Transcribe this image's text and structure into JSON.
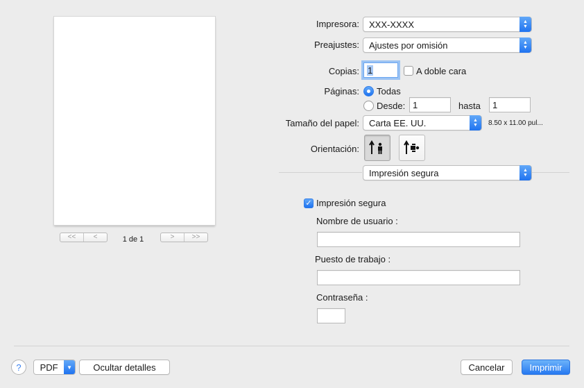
{
  "preview": {
    "page_indicator": "1 de 1",
    "pager_first": "<<",
    "pager_prev": "<",
    "pager_next": ">",
    "pager_last": ">>"
  },
  "printer": {
    "label": "Impresora:",
    "value": "XXX-XXXX"
  },
  "presets": {
    "label": "Preajustes:",
    "value": "Ajustes por omisión"
  },
  "copies": {
    "label": "Copias:",
    "value": "1",
    "duplex_label": "A doble cara",
    "duplex_checked": false
  },
  "pages": {
    "label": "Páginas:",
    "all_label": "Todas",
    "from_label": "Desde:",
    "from_value": "1",
    "to_label": "hasta",
    "to_value": "1",
    "selected": "all"
  },
  "paper": {
    "label": "Tamaño del papel:",
    "value": "Carta EE. UU.",
    "dimensions": "8.50 x 11.00 pul..."
  },
  "orientation": {
    "label": "Orientación:",
    "selected": "portrait"
  },
  "section": {
    "value": "Impresión segura"
  },
  "secure": {
    "checkbox_label": "Impresión segura",
    "checked": true,
    "username_label": "Nombre de usuario :",
    "username_value": "",
    "job_label": "Puesto de trabajo :",
    "job_value": "",
    "password_label": "Contraseña :",
    "password_value": ""
  },
  "footer": {
    "help": "?",
    "pdf_label": "PDF",
    "hide_details": "Ocultar detalles",
    "cancel": "Cancelar",
    "print": "Imprimir"
  },
  "colors": {
    "accent": "#2779f1",
    "background": "#ececec"
  },
  "icons": {
    "popup_arrow": "updown-chevron-icon",
    "pdf_arrow": "chevron-down-icon",
    "portrait": "portrait-orientation-icon",
    "landscape": "landscape-orientation-icon"
  }
}
